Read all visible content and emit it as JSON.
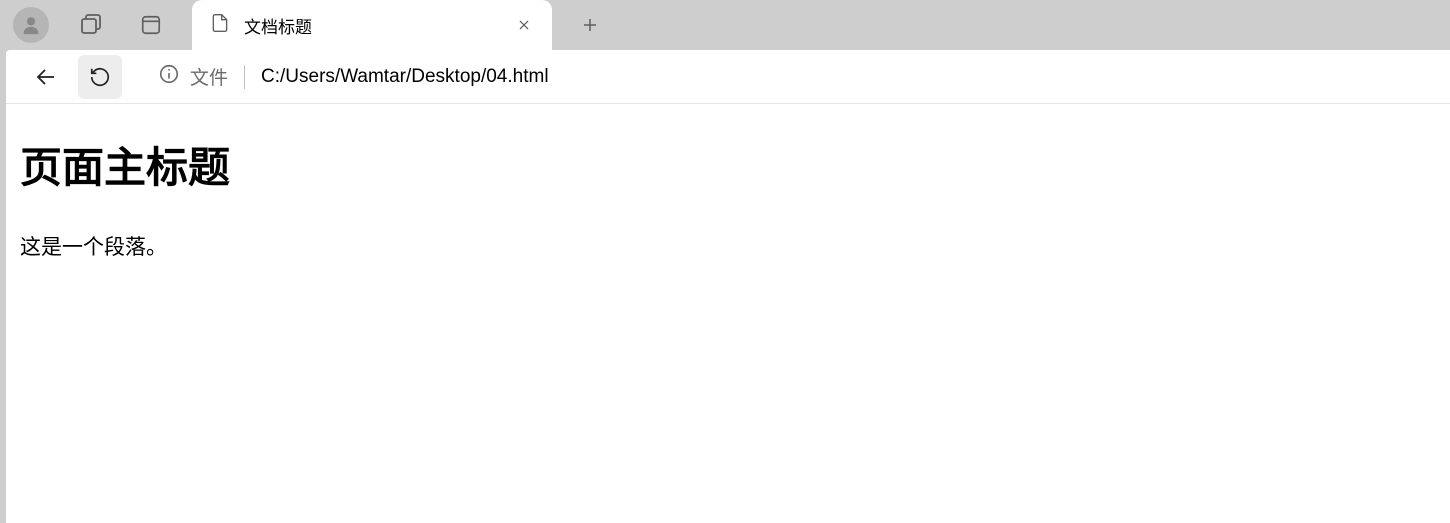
{
  "tab": {
    "title": "文档标题"
  },
  "addressbar": {
    "scheme_label": "文件",
    "url": "C:/Users/Wamtar/Desktop/04.html"
  },
  "content": {
    "heading": "页面主标题",
    "paragraph": "这是一个段落。"
  }
}
